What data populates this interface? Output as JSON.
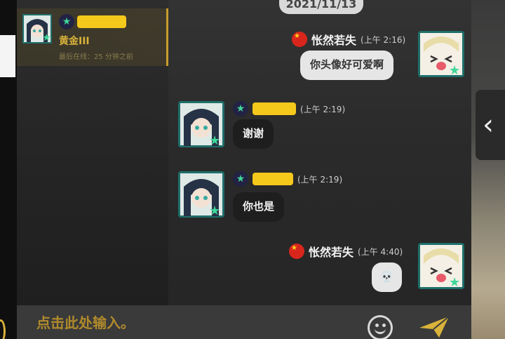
{
  "contact": {
    "tier": "黄金III",
    "last_online": "最后在线：25 分钟之前"
  },
  "chat": {
    "date": "2021/11/13",
    "messages": [
      {
        "side": "right",
        "sender": "怅然若失",
        "time": "(上午 2:16)",
        "text": "你头像好可爱啊"
      },
      {
        "side": "left",
        "time": "(上午 2:19)",
        "text": "谢谢"
      },
      {
        "side": "left",
        "time": "(上午 2:19)",
        "text": "你也是"
      },
      {
        "side": "right",
        "sender": "怅然若失",
        "time": "(上午 4:40)",
        "text": "💀"
      }
    ]
  },
  "input": {
    "placeholder": "点击此处输入。"
  },
  "colors": {
    "accent_gold": "#c99c2e",
    "redact_yellow": "#f5c81c",
    "flag_red": "#d8261c"
  },
  "icons": {
    "emoji": "smiley-icon",
    "send": "send-arrow-icon",
    "collapse": "chevron-left-icon",
    "flag": "china-flag-icon",
    "rank": "star-rank-icon"
  }
}
